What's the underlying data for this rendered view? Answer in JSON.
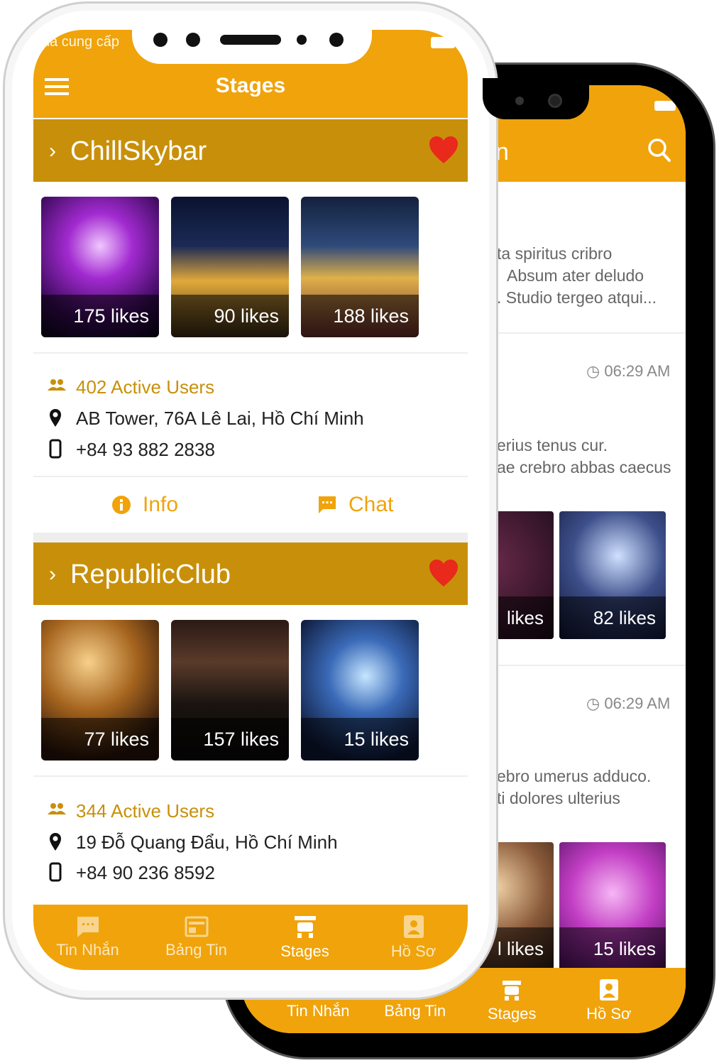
{
  "back": {
    "header_fragment": "n",
    "cards": [
      {
        "time": "",
        "lines": [
          "ta spiritus cribro",
          "Absum ater deludo",
          ". Studio tergeo atqui..."
        ]
      },
      {
        "time": "06:29 AM",
        "lines": [
          "erius tenus cur.",
          "ae crebro abbas caecus"
        ],
        "likes": [
          "likes",
          "82 likes"
        ]
      },
      {
        "time": "06:29 AM",
        "lines": [
          "ebro umerus adduco.",
          "ti dolores ulterius"
        ],
        "likes": [
          "l likes",
          "15 likes"
        ]
      }
    ],
    "tabs": [
      "Tin Nhắn",
      "Bảng Tin",
      "Stages",
      "Hồ Sơ"
    ]
  },
  "front": {
    "carrier": "hà cung cấp",
    "title": "Stages",
    "venues": [
      {
        "name": "ChillSkybar",
        "photos": [
          {
            "likes": "175 likes"
          },
          {
            "likes": "90 likes"
          },
          {
            "likes": "188 likes"
          }
        ],
        "active_users": "402 Active Users",
        "address": "AB Tower, 76A Lê Lai, Hồ Chí Minh",
        "phone": "+84 93 882 2838"
      },
      {
        "name": "RepublicClub",
        "photos": [
          {
            "likes": "77 likes"
          },
          {
            "likes": "157 likes"
          },
          {
            "likes": "15 likes"
          }
        ],
        "active_users": "344 Active Users",
        "address": "19 Đỗ Quang Đẩu, Hồ Chí Minh",
        "phone": "+84 90 236 8592"
      }
    ],
    "actions": {
      "info": "Info",
      "chat": "Chat"
    },
    "tabs": [
      "Tin Nhắn",
      "Bảng Tin",
      "Stages",
      "Hồ Sơ"
    ]
  },
  "colors": {
    "accent": "#f0a30a",
    "venue_header": "#c8900a",
    "heart": "#e8291c"
  }
}
